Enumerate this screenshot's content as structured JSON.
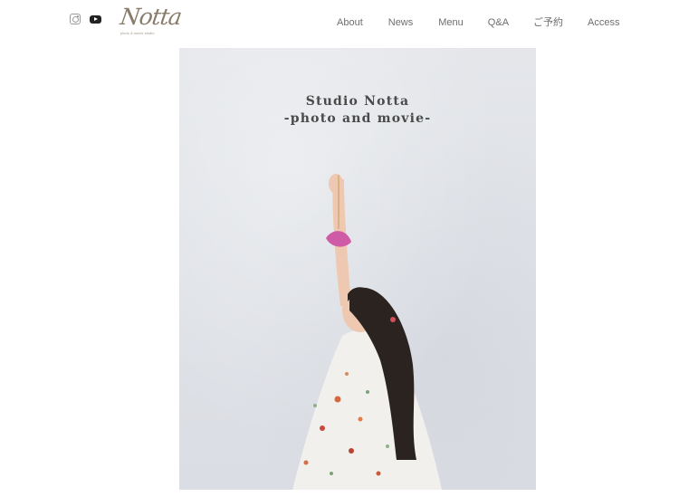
{
  "header": {
    "logo_text": "Notta",
    "logo_subtext": "photo & movie studio",
    "nav": [
      "About",
      "News",
      "Menu",
      "Q&A",
      "ご予約",
      "Access"
    ]
  },
  "hero": {
    "title_line1": "Studio Notta",
    "title_line2": "-photo and movie-"
  },
  "colors": {
    "nav_text": "#6e6e6e",
    "logo": "#8a7c6a",
    "hero_bg": "#e0e3e8",
    "title": "#4a4a4a"
  },
  "icons": [
    "instagram-icon",
    "youtube-icon"
  ]
}
